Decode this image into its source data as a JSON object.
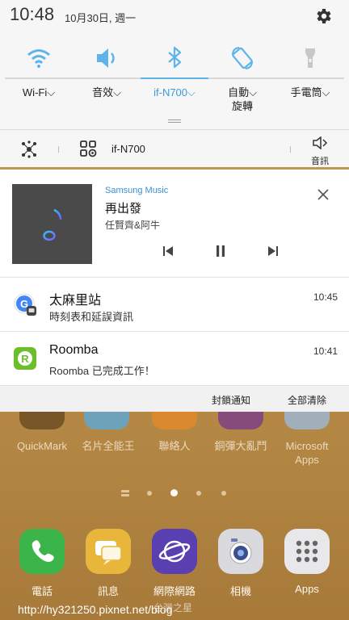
{
  "status": {
    "time": "10:48",
    "date": "10月30日, 週一"
  },
  "quick_tiles": [
    {
      "label": "Wi-Fi",
      "icon": "wifi-icon",
      "active": false
    },
    {
      "label": "音效",
      "icon": "volume-icon",
      "active": false
    },
    {
      "label": "if-N700",
      "icon": "bluetooth-icon",
      "active": true
    },
    {
      "label": "自動\n旋轉",
      "icon": "auto-rotate-icon",
      "active": false
    },
    {
      "label": "手電筒",
      "icon": "flashlight-icon",
      "active": false
    }
  ],
  "device_row": {
    "device_name": "if-N700",
    "sound_label": "音訊"
  },
  "media": {
    "app": "Samsung Music",
    "song": "再出發",
    "artist": "任賢齊&阿牛"
  },
  "notifications": [
    {
      "title": "太麻里站",
      "body": "時刻表和延誤資訊",
      "time": "10:45",
      "icon": "google-icon"
    },
    {
      "title": "Roomba",
      "body": "Roomba 已完成工作！",
      "time": "10:41",
      "icon": "roomba-icon"
    }
  ],
  "actions": {
    "block": "封鎖通知",
    "clear": "全部清除"
  },
  "home_apps": [
    {
      "label": "QuickMark"
    },
    {
      "label": "名片全能王"
    },
    {
      "label": "聯絡人"
    },
    {
      "label": "銅彈大亂鬥"
    },
    {
      "label": "Microsoft\nApps"
    }
  ],
  "dock": [
    {
      "label": "電話",
      "icon": "phone-icon"
    },
    {
      "label": "訊息",
      "icon": "messages-icon"
    },
    {
      "label": "網際網路",
      "icon": "internet-icon"
    },
    {
      "label": "相機",
      "icon": "camera-icon"
    },
    {
      "label": "Apps",
      "icon": "apps-icon"
    }
  ],
  "watermark": "http://hy321250.pixnet.net/blog",
  "watermark_extra": "台灣之星",
  "colors": {
    "accent": "#3b9bd9",
    "panel": "#f6f6f6",
    "wallpaper": "#c9a15f"
  }
}
